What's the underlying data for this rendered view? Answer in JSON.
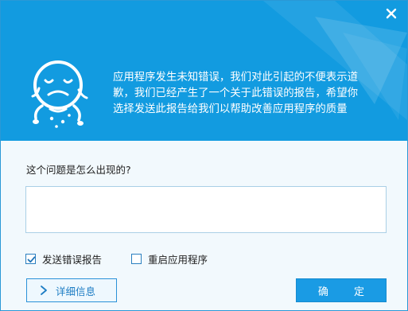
{
  "dialog": {
    "message": "应用程序发生未知错误，我们对此引起的不便表示道歉，我们已经产生了一个关于此错误的报告，希望你选择发送此报告给我们以帮助改善应用程序的质量",
    "message_lines": [
      "应用程序发生未知错误，我们对此引起的不便表示道",
      "歉，我们已经产生了一个关于此错误的报告，希望你",
      "选择发送此报告给我们以帮助改善应用程序的质量"
    ],
    "question_label": "这个问题是怎么出现的?",
    "feedback_value": "",
    "options": {
      "send_report": {
        "label": "发送错误报告",
        "checked": true
      },
      "restart_app": {
        "label": "重启应用程序",
        "checked": false
      }
    },
    "details_button": "详细信息",
    "ok_button": "确 定"
  },
  "colors": {
    "header_bg": "#129be0",
    "accent": "#1a9be4",
    "button_text": "#1d7dc4"
  },
  "icons": [
    "close-icon",
    "crying-mascot-icon",
    "checkmark-icon",
    "chevron-right-icon"
  ]
}
